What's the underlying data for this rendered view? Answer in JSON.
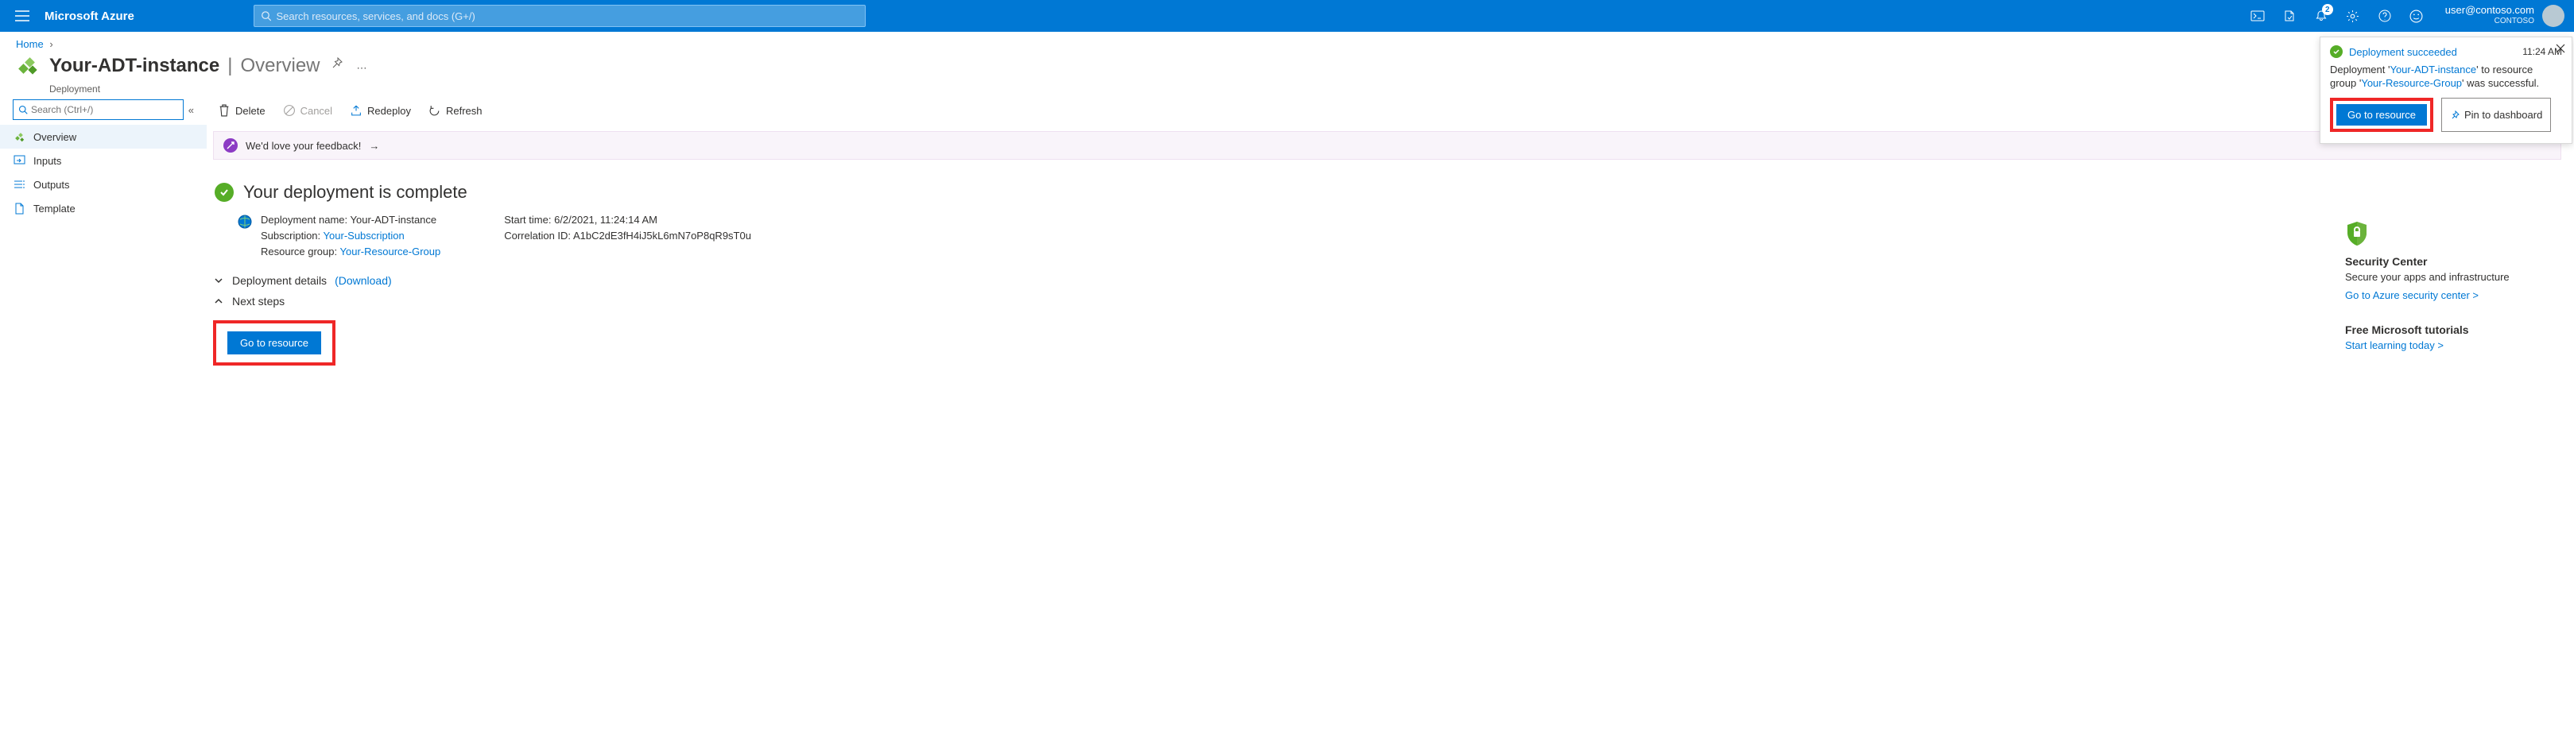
{
  "brand": "Microsoft Azure",
  "search": {
    "placeholder": "Search resources, services, and docs (G+/)"
  },
  "notifications_count": "2",
  "user": {
    "email": "user@contoso.com",
    "tenant": "CONTOSO"
  },
  "breadcrumb": {
    "home": "Home"
  },
  "page": {
    "title": "Your-ADT-instance",
    "separator": "|",
    "section": "Overview",
    "kind": "Deployment"
  },
  "sidebar": {
    "search_placeholder": "Search (Ctrl+/)",
    "items": [
      {
        "label": "Overview",
        "icon": "cubes-icon"
      },
      {
        "label": "Inputs",
        "icon": "inputs-icon"
      },
      {
        "label": "Outputs",
        "icon": "outputs-icon"
      },
      {
        "label": "Template",
        "icon": "template-icon"
      }
    ]
  },
  "toolbar": {
    "delete": "Delete",
    "cancel": "Cancel",
    "redeploy": "Redeploy",
    "refresh": "Refresh"
  },
  "feedback": {
    "text": "We'd love your feedback!"
  },
  "complete": {
    "title": "Your deployment is complete",
    "dep_lbl": "Deployment name:",
    "dep_val": "Your-ADT-instance",
    "sub_lbl": "Subscription:",
    "sub_val": "Your-Subscription",
    "rg_lbl": "Resource group:",
    "rg_val": "Your-Resource-Group",
    "start_lbl": "Start time:",
    "start_val": "6/2/2021, 11:24:14 AM",
    "corr_lbl": "Correlation ID:",
    "corr_val": "A1bC2dE3fH4iJ5kL6mN7oP8qR9sT0u"
  },
  "sections": {
    "details_title": "Deployment details",
    "details_link": "(Download)",
    "next_title": "Next steps",
    "goto_btn": "Go to resource"
  },
  "right_rail": {
    "sc_head": "Security Center",
    "sc_text": "Secure your apps and infrastructure",
    "sc_link": "Go to Azure security center >",
    "tut_head": "Free Microsoft tutorials",
    "tut_link": "Start learning today >"
  },
  "toast": {
    "title": "Deployment succeeded",
    "time": "11:24 AM",
    "body_pre": "Deployment '",
    "body_link1": "Your-ADT-instance",
    "body_mid": "' to resource group '",
    "body_link2": "Your-Resource-Group",
    "body_post": "' was successful.",
    "goto": "Go to resource",
    "pin": "Pin to dashboard"
  }
}
